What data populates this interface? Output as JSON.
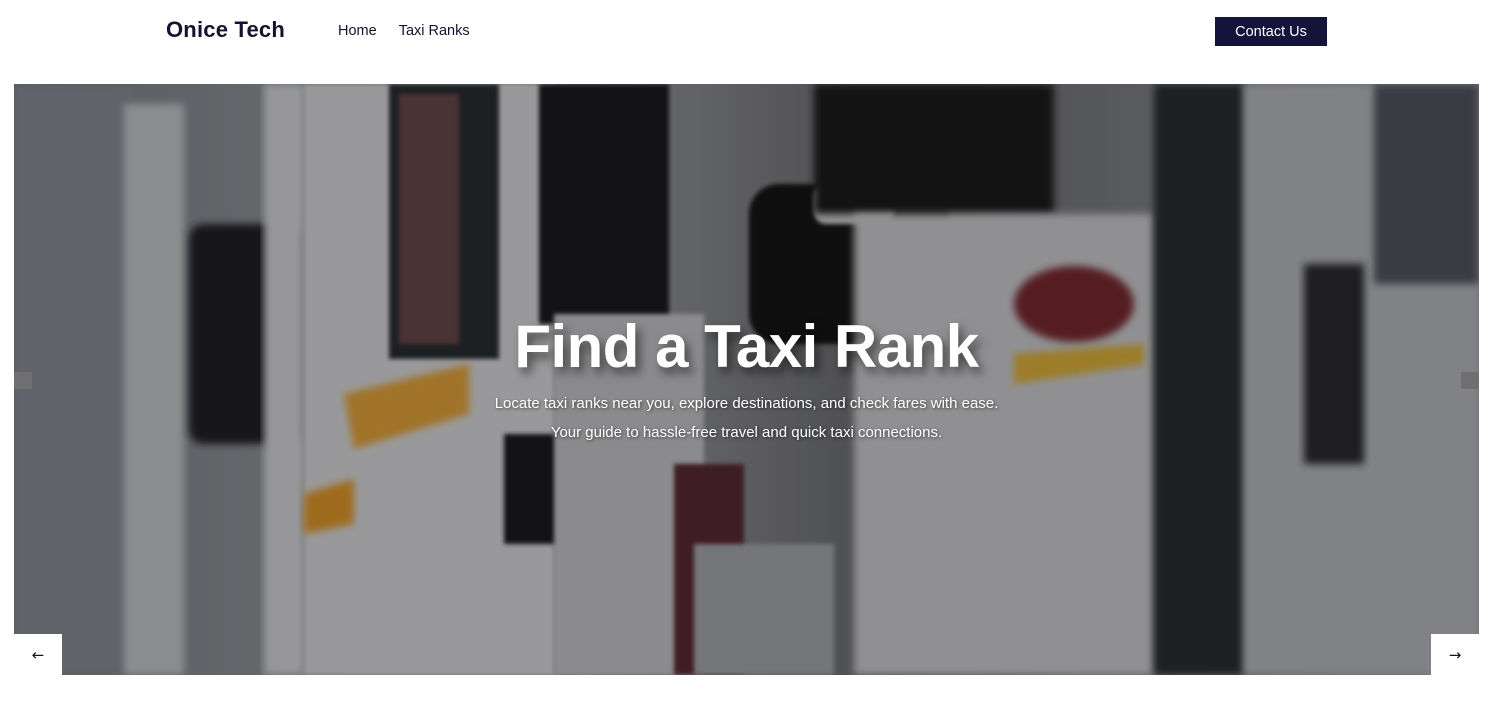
{
  "header": {
    "brand": "Onice Tech",
    "nav": [
      {
        "label": "Home"
      },
      {
        "label": "Taxi Ranks"
      }
    ],
    "contact_label": "Contact Us"
  },
  "hero": {
    "title": "Find a Taxi Rank",
    "subtitle_line1": "Locate taxi ranks near you, explore destinations, and check fares with ease.",
    "subtitle_line2": "Your guide to hassle-free travel and quick taxi connections.",
    "prev_icon": "←",
    "next_icon": "→"
  },
  "colors": {
    "brand_dark": "#14133a",
    "text": "#14122e"
  }
}
